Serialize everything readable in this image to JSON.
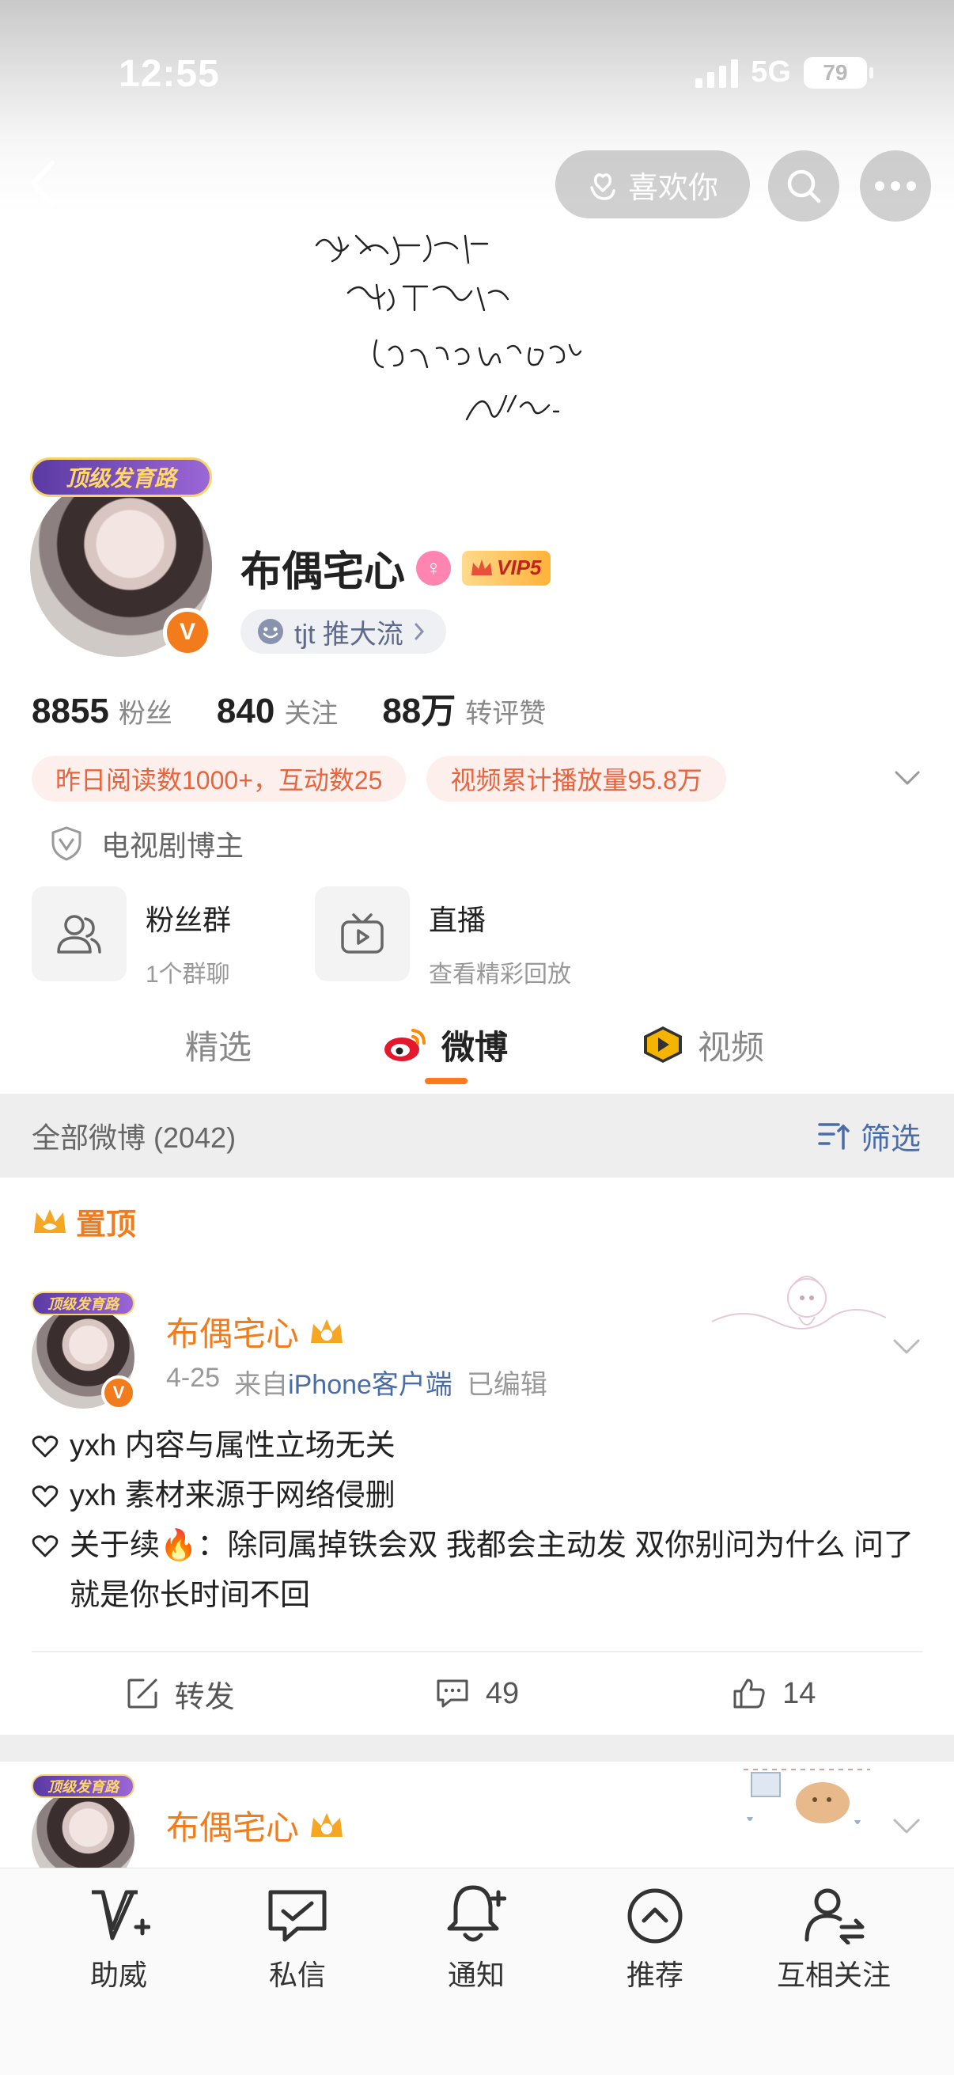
{
  "status_bar": {
    "time": "12:55",
    "network": "5G",
    "battery": "79"
  },
  "header": {
    "like_label": "喜欢你"
  },
  "profile": {
    "avatar_badge": "顶级发育路",
    "name": "布偶宅心",
    "vip_label": "VIP5",
    "tag_label": "tjt 推大流",
    "stats": [
      {
        "value": "8855",
        "label": "粉丝"
      },
      {
        "value": "840",
        "label": "关注"
      },
      {
        "value": "88万",
        "label": "转评赞"
      }
    ],
    "chips": [
      "昨日阅读数1000+，互动数25",
      "视频累计播放量95.8万"
    ],
    "role": "电视剧博主",
    "features": [
      {
        "title": "粉丝群",
        "subtitle": "1个群聊"
      },
      {
        "title": "直播",
        "subtitle": "查看精彩回放"
      }
    ]
  },
  "tabs": [
    {
      "label": "精选"
    },
    {
      "label": "微博"
    },
    {
      "label": "视频"
    }
  ],
  "feed": {
    "count_label": "全部微博 (2042)",
    "filter_label": "筛选",
    "pinned_label": "置顶",
    "posts": [
      {
        "badge": "顶级发育路",
        "name": "布偶宅心",
        "date": "4-25",
        "from_prefix": "来自",
        "source": "iPhone客户端",
        "edited": "已编辑",
        "lines": [
          "yxh 内容与属性立场无关",
          "yxh 素材来源于网络侵删",
          "关于续🔥：除同属掉铁会双 我都会主动发 双你别问为什么 问了就是你长时间不回"
        ],
        "repost_label": "转发",
        "comments": "49",
        "likes": "14"
      },
      {
        "badge": "顶级发育路",
        "name": "布偶宅心"
      }
    ]
  },
  "bottom_nav": [
    {
      "label": "助威",
      "icon": "v-plus-icon"
    },
    {
      "label": "私信",
      "icon": "message-icon"
    },
    {
      "label": "通知",
      "icon": "bell-icon"
    },
    {
      "label": "推荐",
      "icon": "up-circle-icon"
    },
    {
      "label": "互相关注",
      "icon": "mutual-follow-icon"
    }
  ],
  "colors": {
    "accent": "#f27b1c",
    "link": "#4a6da8",
    "chip_text": "#e8643e",
    "chip_bg": "#fdf0ec"
  }
}
